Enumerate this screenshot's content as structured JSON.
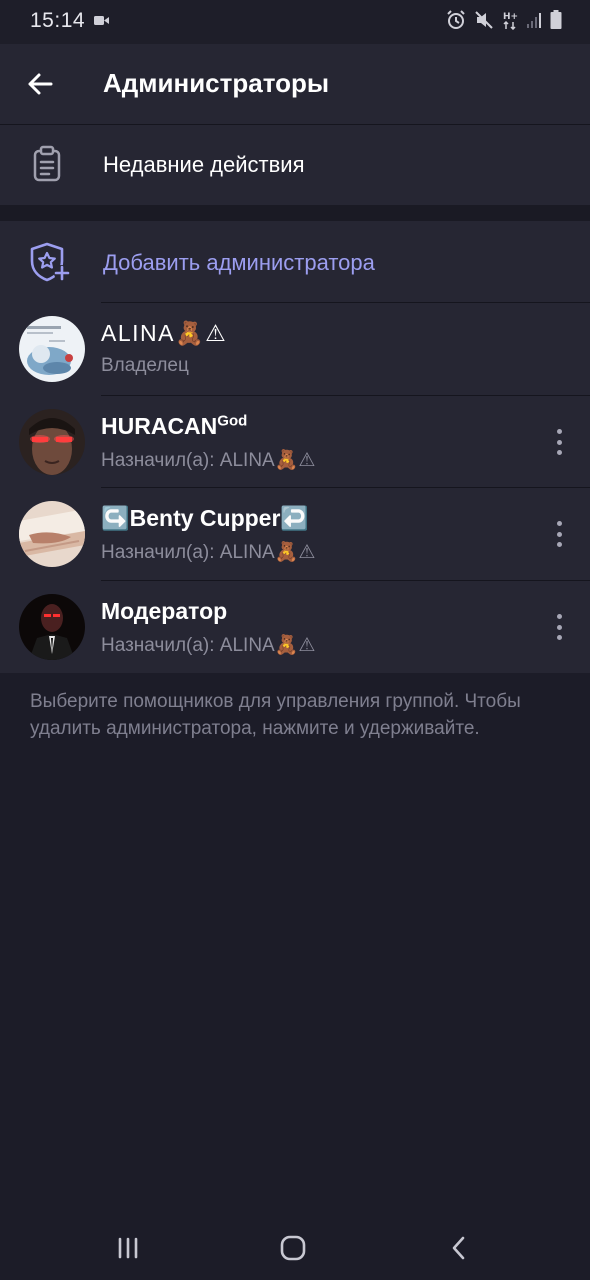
{
  "status_bar": {
    "time": "15:14",
    "icons": [
      "camera-icon",
      "alarm-icon",
      "mute-icon",
      "network-icon",
      "signal-icon",
      "battery-icon"
    ]
  },
  "header": {
    "title": "Администраторы",
    "back_icon": "arrow-left-icon"
  },
  "recent_actions": {
    "label": "Недавние действия",
    "icon": "clipboard-icon"
  },
  "add_admin": {
    "label": "Добавить администратора",
    "icon": "shield-star-plus-icon",
    "color": "#9c9ef0"
  },
  "admins": [
    {
      "name": "ALINA🧸⚠",
      "subtitle": "Владелец",
      "has_menu": false
    },
    {
      "name": "HURACAN",
      "name_sup": "God",
      "subtitle": "Назначил(а): ALINA🧸⚠",
      "has_menu": true
    },
    {
      "name": "↪️Benty Cupper↩️",
      "subtitle": "Назначил(а): ALINA🧸⚠",
      "has_menu": true
    },
    {
      "name": "Модератор",
      "subtitle": "Назначил(а): ALINA🧸⚠",
      "has_menu": true
    }
  ],
  "footer_hint": "Выберите помощников для управления группой. Чтобы удалить администратора, нажмите и удерживайте.",
  "nav_bar": {
    "buttons": [
      "recent-apps-icon",
      "home-icon",
      "back-icon"
    ]
  },
  "colors": {
    "background": "#1c1c28",
    "surface": "#262633",
    "accent": "#9c9ef0",
    "secondary_text": "#8d8d9c"
  }
}
